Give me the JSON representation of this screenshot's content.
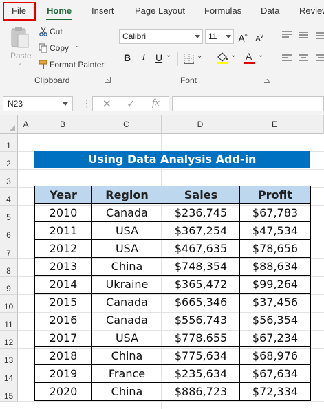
{
  "menu": {
    "tabs": [
      {
        "label": "File"
      },
      {
        "label": "Home"
      },
      {
        "label": "Insert"
      },
      {
        "label": "Page Layout"
      },
      {
        "label": "Formulas"
      },
      {
        "label": "Data"
      },
      {
        "label": "Review"
      }
    ],
    "active_tab": "Home",
    "highlight_color": "#e00000"
  },
  "ribbon": {
    "clipboard": {
      "paste": "Paste",
      "cut": "Cut",
      "copy": "Copy",
      "format_painter": "Format Painter",
      "label": "Clipboard"
    },
    "font": {
      "font_name": "Calibri",
      "font_size": "11",
      "grow_label": "A",
      "shrink_label": "A",
      "bold": "B",
      "italic": "I",
      "underline": "U",
      "font_color_label": "A",
      "label": "Font"
    }
  },
  "formula_bar": {
    "name_box": "N23",
    "fx": "fx",
    "formula": ""
  },
  "sheet": {
    "columns": [
      "A",
      "B",
      "C",
      "D",
      "E"
    ],
    "rows": [
      "1",
      "2",
      "3",
      "4",
      "5",
      "6",
      "7",
      "8",
      "9",
      "10",
      "11",
      "12",
      "13",
      "14",
      "15"
    ],
    "banner": "Using Data Analysis Add-in",
    "banner_color": "#0070c0",
    "header_fill": "#bdd7ee",
    "table": {
      "headers": [
        "Year",
        "Region",
        "Sales",
        "Profit"
      ],
      "rows": [
        [
          "2010",
          "Canada",
          "$236,745",
          "$67,783"
        ],
        [
          "2011",
          "USA",
          "$367,254",
          "$47,534"
        ],
        [
          "2012",
          "USA",
          "$467,635",
          "$78,656"
        ],
        [
          "2013",
          "China",
          "$748,354",
          "$88,634"
        ],
        [
          "2014",
          "Ukraine",
          "$365,472",
          "$99,264"
        ],
        [
          "2015",
          "Canada",
          "$665,346",
          "$37,456"
        ],
        [
          "2016",
          "Canada",
          "$556,743",
          "$56,354"
        ],
        [
          "2017",
          "USA",
          "$778,655",
          "$67,234"
        ],
        [
          "2018",
          "China",
          "$775,634",
          "$68,976"
        ],
        [
          "2019",
          "France",
          "$235,634",
          "$67,634"
        ],
        [
          "2020",
          "China",
          "$886,723",
          "$72,334"
        ]
      ]
    }
  }
}
